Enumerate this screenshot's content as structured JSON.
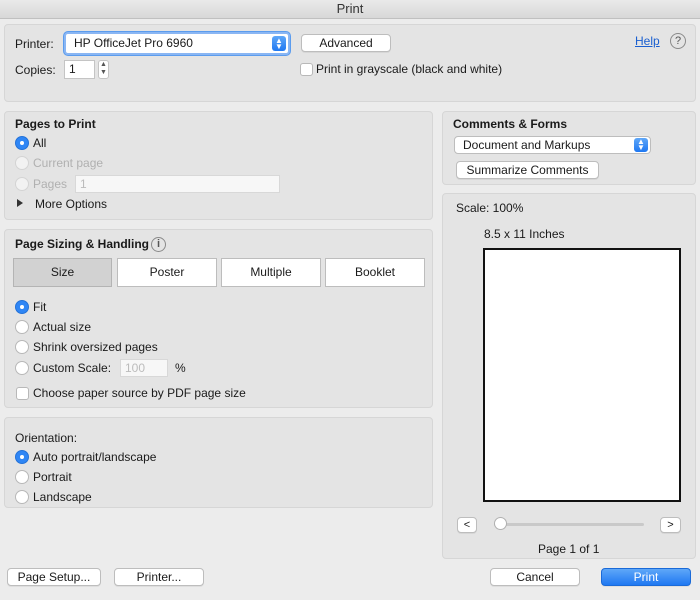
{
  "window": {
    "title": "Print"
  },
  "printer": {
    "label": "Printer:",
    "selected": "HP OfficeJet Pro 6960"
  },
  "advanced_button": "Advanced",
  "help_link": "Help",
  "help_icon": "?",
  "copies": {
    "label": "Copies:",
    "value": "1"
  },
  "grayscale": {
    "label": "Print in grayscale (black and white)",
    "checked": false
  },
  "pages_to_print": {
    "heading": "Pages to Print",
    "all": "All",
    "current_page": "Current page",
    "pages": "Pages",
    "pages_value": "1",
    "more_options": "More Options",
    "selected": "All"
  },
  "sizing": {
    "heading": "Page Sizing & Handling",
    "info_icon": "i",
    "tabs": [
      "Size",
      "Poster",
      "Multiple",
      "Booklet"
    ],
    "active_tab": "Size",
    "fit": "Fit",
    "actual_size": "Actual size",
    "shrink": "Shrink oversized pages",
    "custom_scale": "Custom Scale:",
    "custom_scale_value": "100",
    "percent": "%",
    "paper_source": "Choose paper source by PDF page size",
    "selected": "Fit"
  },
  "orientation": {
    "heading": "Orientation:",
    "auto": "Auto portrait/landscape",
    "portrait": "Portrait",
    "landscape": "Landscape",
    "selected": "Auto portrait/landscape"
  },
  "comments_forms": {
    "heading": "Comments & Forms",
    "selected": "Document and Markups",
    "summarize_button": "Summarize Comments"
  },
  "preview": {
    "scale": "Scale: 100%",
    "paper_size": "8.5 x 11 Inches",
    "prev": "<",
    "next": ">",
    "page_indicator": "Page 1 of 1",
    "slider_value": 0
  },
  "footer": {
    "page_setup": "Page Setup...",
    "printer": "Printer...",
    "cancel": "Cancel",
    "print": "Print"
  },
  "colors": {
    "accent": "#2f86f5",
    "panel": "#e4e4e4",
    "background": "#ececec"
  }
}
